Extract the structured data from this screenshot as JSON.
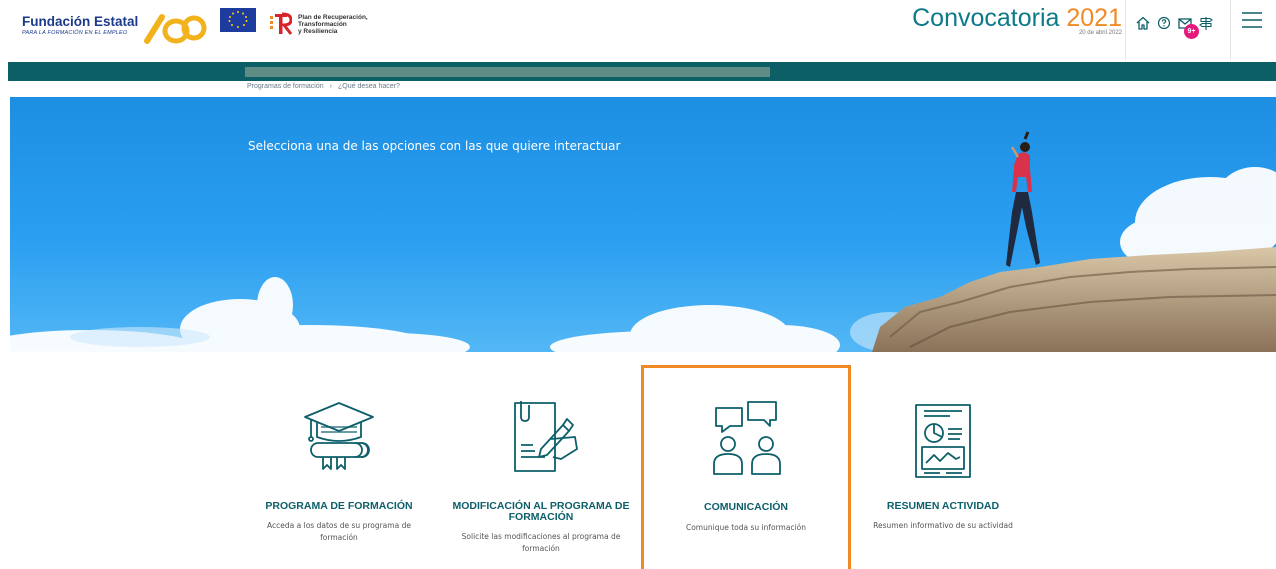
{
  "header": {
    "brand_name": "Fundación Estatal",
    "brand_sub": "PARA LA FORMACIÓN EN EL EMPLEO",
    "prtr_lines": [
      "Plan de Recuperación,",
      "Transformación",
      "y Resiliencia"
    ],
    "convocatoria_label": "Convocatoria",
    "convocatoria_year": "2021",
    "convocatoria_date": "20 de abril 2022",
    "badge": "9+",
    "icons": [
      "home-icon",
      "help-icon",
      "mail-icon",
      "signpost-icon",
      "hamburger-menu-icon"
    ]
  },
  "breadcrumb": {
    "items": [
      "Programas de formación",
      "¿Qué desea hacer?"
    ],
    "separator": "›"
  },
  "hero": {
    "text": "Selecciona una de las opciones con las que quiere interactuar"
  },
  "cards": [
    {
      "title": "PROGRAMA DE FORMACIÓN",
      "desc": "Acceda a los datos de su programa de formación",
      "icon": "graduation-cap-icon"
    },
    {
      "title": "MODIFICACIÓN AL PROGRAMA DE FORMACIÓN",
      "desc": "Solicite las modificaciones al programa de formación",
      "icon": "document-signing-icon"
    },
    {
      "title": "COMUNICACIÓN",
      "desc": "Comunique toda su información",
      "icon": "people-chat-icon"
    },
    {
      "title": "RESUMEN ACTIVIDAD",
      "desc": "Resumen informativo de su actividad",
      "icon": "report-chart-icon"
    }
  ],
  "colors": {
    "accent_teal": "#0d5f66",
    "accent_orange": "#f08a24",
    "badge_pink": "#e6187a",
    "sky_blue": "#1d8fe3"
  }
}
